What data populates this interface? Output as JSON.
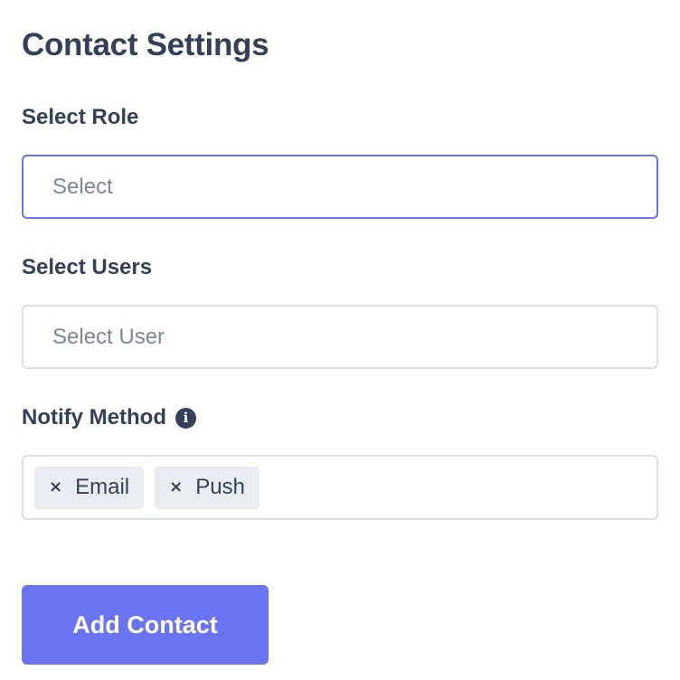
{
  "header": {
    "title": "Contact Settings"
  },
  "role": {
    "label": "Select Role",
    "placeholder": "Select"
  },
  "users": {
    "label": "Select Users",
    "placeholder": "Select User"
  },
  "notify": {
    "label": "Notify Method",
    "info_icon": "info-icon",
    "tags": [
      {
        "remove_icon": "×",
        "label": "Email"
      },
      {
        "remove_icon": "×",
        "label": "Push"
      }
    ]
  },
  "actions": {
    "add_contact_label": "Add Contact"
  },
  "colors": {
    "accent": "#6b74f0",
    "text": "#34405a",
    "placeholder": "#7b8799",
    "border": "#d9dee6",
    "tag_bg": "#e9ecf0"
  }
}
